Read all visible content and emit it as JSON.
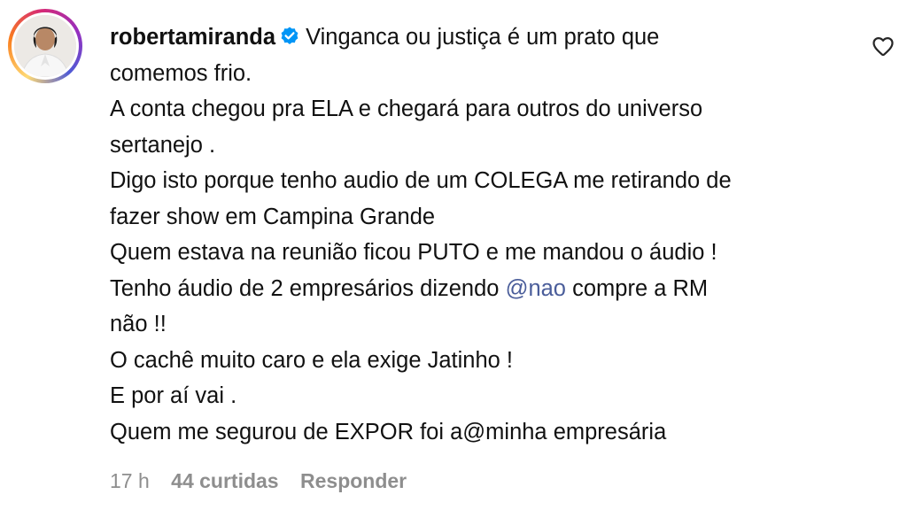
{
  "comment": {
    "username": "robertamiranda",
    "verified_icon": "verified-badge-icon",
    "lines": [
      "Vinganca ou justiça é um prato que",
      "comemos frio.",
      "A conta chegou pra ELA e chegará para outros do universo",
      "sertanejo .",
      "Digo isto porque tenho audio de um COLEGA me retirando de",
      "fazer show em Campina Grande",
      "Quem estava na reunião ficou PUTO e me mandou o áudio !",
      "Tenho áudio de 2 empresários dizendo",
      "compre a RM",
      "não !!",
      "O cachê muito caro e ela exige Jatinho !",
      "E por aí vai .",
      "Quem me segurou de EXPOR foi a@minha empresária"
    ],
    "mention": "@nao",
    "mention_color": "#4a5d9a",
    "timestamp": "17 h",
    "likes": "44 curtidas",
    "reply_label": "Responder",
    "like_icon": "heart-icon"
  }
}
